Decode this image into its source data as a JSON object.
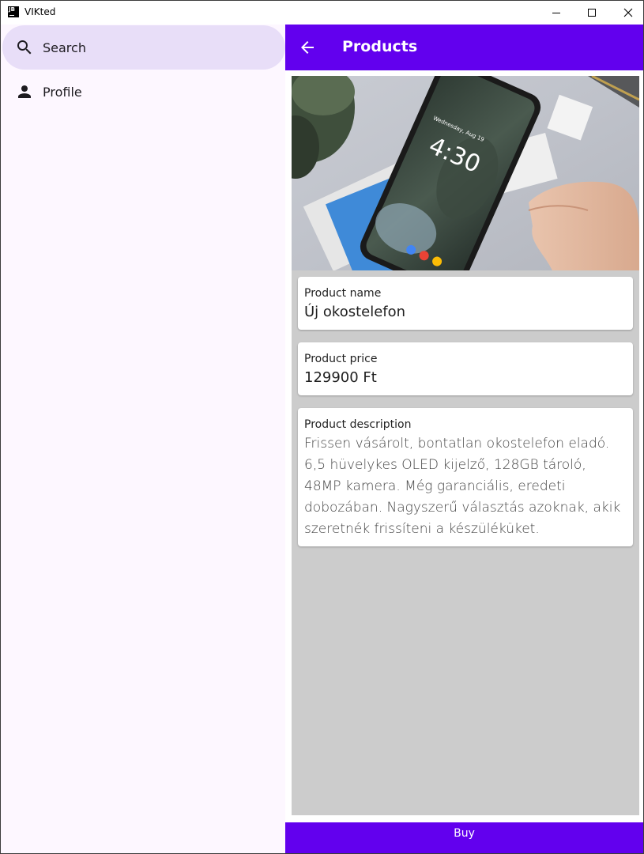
{
  "window": {
    "logo_text": "JB",
    "title": "VIKted"
  },
  "sidebar": {
    "items": [
      {
        "label": "Search",
        "icon": "search-icon",
        "active": true
      },
      {
        "label": "Profile",
        "icon": "person-icon",
        "active": false
      }
    ]
  },
  "appbar": {
    "title": "Products",
    "back_icon": "arrow-back-icon"
  },
  "product": {
    "image_alt": "smartphone-photo",
    "phone_clock": "4:30",
    "phone_date": "Wednesday, Aug 19",
    "name_label": "Product name",
    "name_value": "Új okostelefon",
    "price_label": "Product price",
    "price_value": "129900 Ft",
    "description_label": "Product description",
    "description_value": "Frissen vásárolt, bontatlan okostelefon eladó. 6,5 hüvelykes OLED kijelző, 128GB tároló, 48MP kamera. Még garanciális, eredeti dobozában. Nagyszerű választás azoknak, akik szeretnék frissíteni a készüléküket."
  },
  "actions": {
    "buy_label": "Buy"
  },
  "colors": {
    "primary": "#6200ee",
    "sidebar_bg": "#fdf7ff",
    "nav_active_bg": "#e8def8",
    "content_bg": "#cccccc"
  }
}
